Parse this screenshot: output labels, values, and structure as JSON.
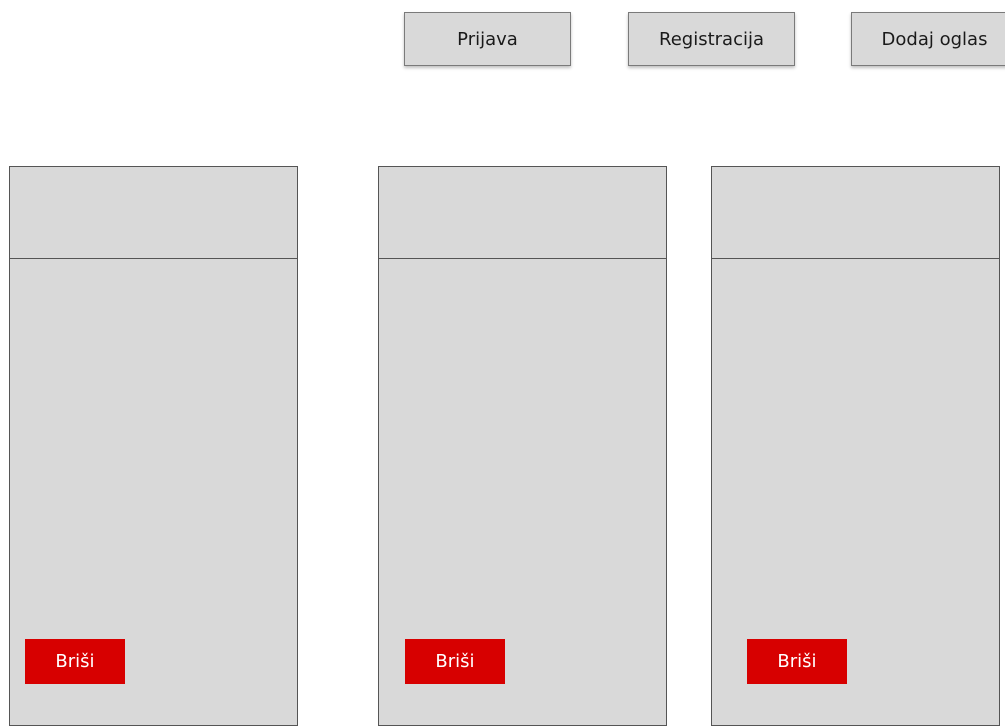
{
  "nav": {
    "login_label": "Prijava",
    "register_label": "Registracija",
    "add_ad_label": "Dodaj oglas"
  },
  "cards": [
    {
      "delete_label": "Briši"
    },
    {
      "delete_label": "Briši"
    },
    {
      "delete_label": "Briši"
    }
  ]
}
